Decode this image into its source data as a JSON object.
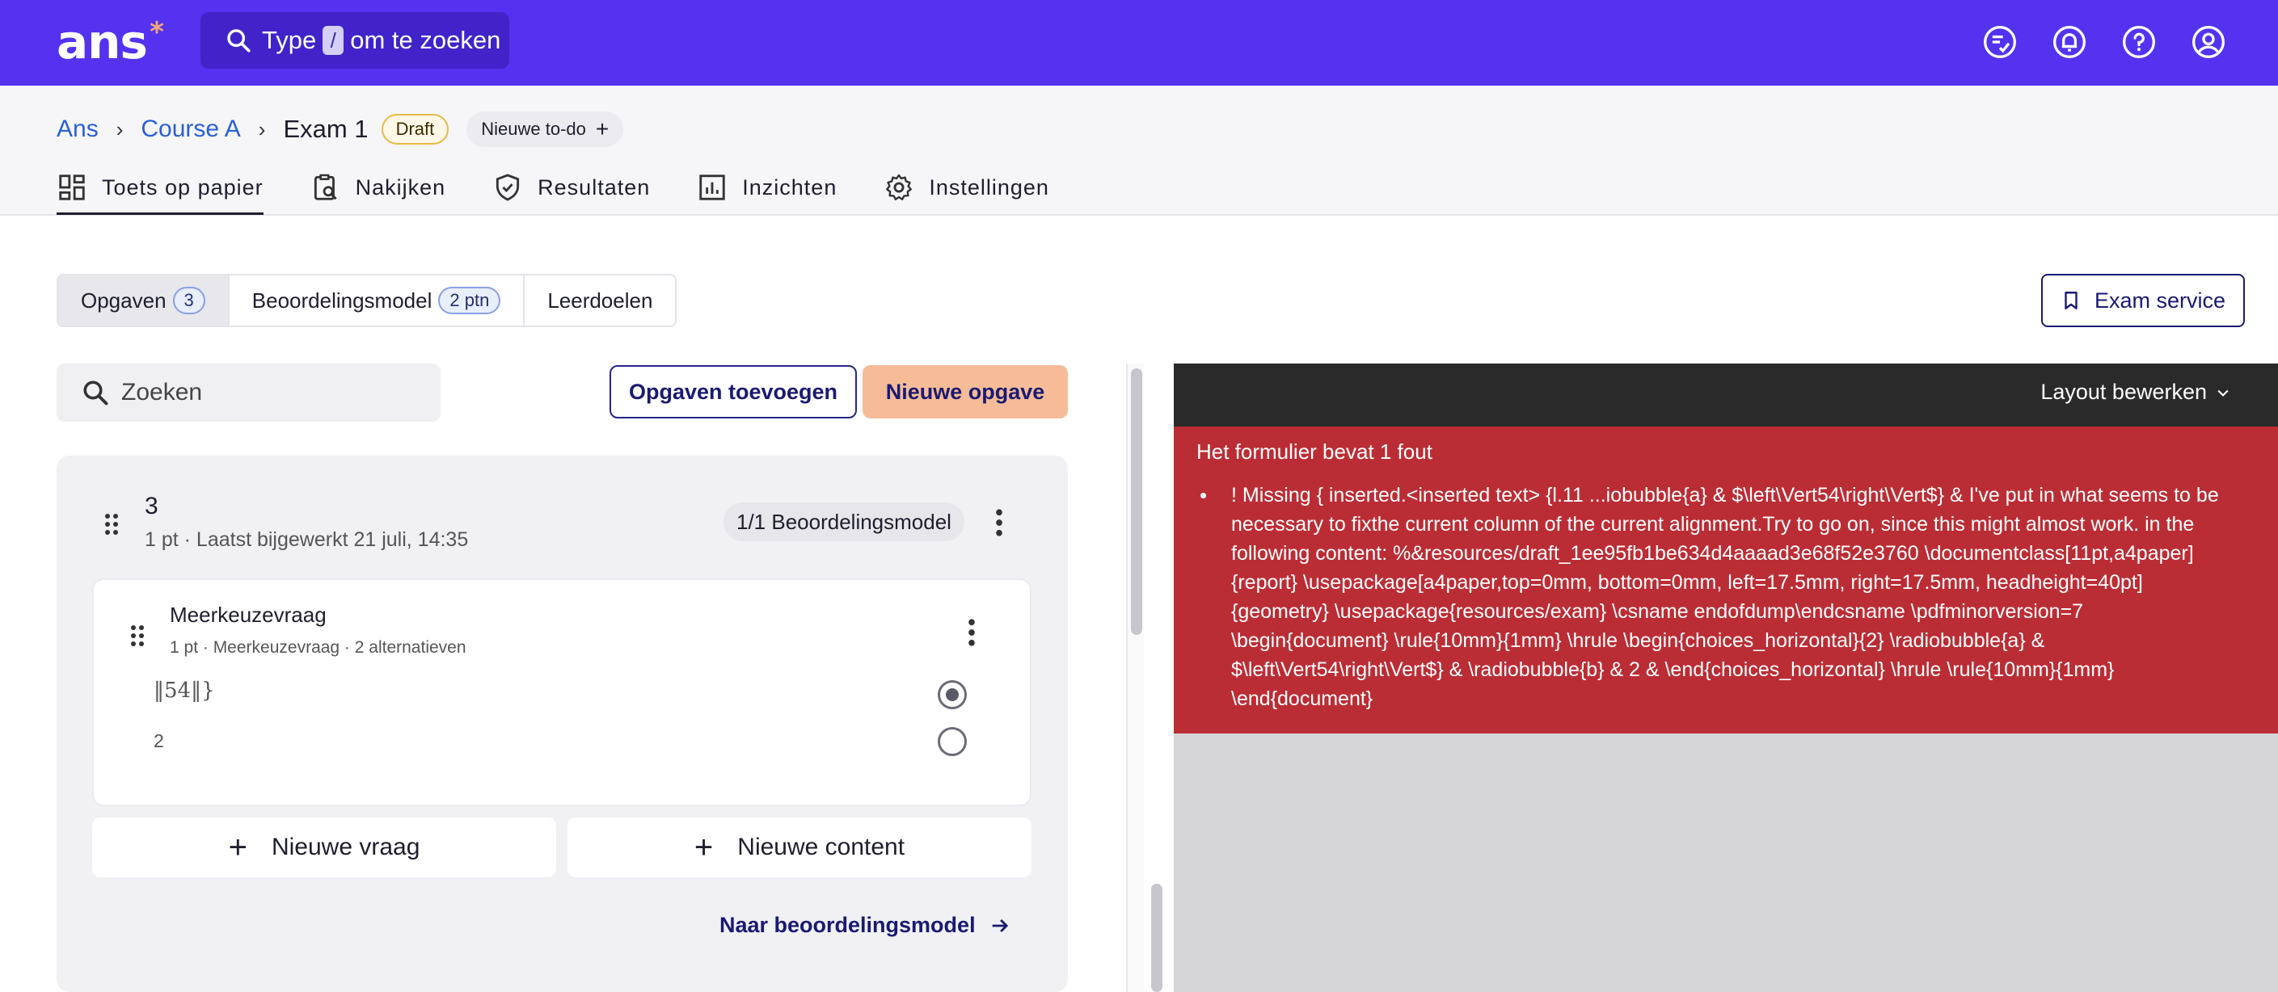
{
  "app": {
    "logo": "ans",
    "logo_star": "*",
    "search": {
      "prefix": "Type",
      "key": "/",
      "suffix": "om te zoeken"
    },
    "top_icons": [
      "todo-list-icon",
      "notification-bell-icon",
      "help-icon",
      "account-icon"
    ]
  },
  "breadcrumb": {
    "items": [
      "Ans",
      "Course A"
    ],
    "current": "Exam 1",
    "status_badge": "Draft",
    "todo_button": "Nieuwe to-do"
  },
  "tabs": [
    {
      "label": "Toets op papier",
      "icon": "dashboard-icon",
      "active": true
    },
    {
      "label": "Nakijken",
      "icon": "clipboard-search-icon",
      "active": false
    },
    {
      "label": "Resultaten",
      "icon": "shield-check-icon",
      "active": false
    },
    {
      "label": "Inzichten",
      "icon": "bar-chart-icon",
      "active": false
    },
    {
      "label": "Instellingen",
      "icon": "gear-icon",
      "active": false
    }
  ],
  "segments": {
    "opgaven": {
      "label": "Opgaven",
      "count": "3"
    },
    "beoordelingsmodel": {
      "label": "Beoordelingsmodel",
      "count": "2 ptn"
    },
    "leerdoelen": {
      "label": "Leerdoelen"
    }
  },
  "exam_service": "Exam service",
  "left": {
    "search_placeholder": "Zoeken",
    "add_existing": "Opgaven toevoegen",
    "new_exercise": "Nieuwe opgave",
    "exercise": {
      "number": "3",
      "meta": "1 pt · Laatst bijgewerkt 21 juli, 14:35",
      "model_badge": "1/1 Beoordelingsmodel",
      "question": {
        "type": "Meerkeuzevraag",
        "meta": "1 pt · Meerkeuzevraag · 2 alternatieven",
        "alternatives": [
          {
            "text": "‖54‖}",
            "selected": true
          },
          {
            "text": "2",
            "selected": false
          }
        ]
      },
      "new_question": "Nieuwe vraag",
      "new_content": "Nieuwe content",
      "to_model": "Naar beoordelingsmodel"
    }
  },
  "preview": {
    "layout_button": "Layout bewerken",
    "error_title": "Het formulier bevat 1 fout",
    "error_lines": [
      "! Missing { inserted.<inserted text> {l.11 ...iobubble{a} & $\\left\\Vert54\\right\\Vert$} & I've put in what seems to be",
      "necessary to fixthe current column of the current alignment.Try to go on, since this might almost work. in the",
      "following content: %&resources/draft_1ee95fb1be634d4aaaad3e68f52e3760 \\documentclass[11pt,a4paper]",
      "{report} \\usepackage[a4paper,top=0mm, bottom=0mm, left=17.5mm, right=17.5mm, headheight=40pt]",
      "{geometry} \\usepackage{resources/exam} \\csname endofdump\\endcsname \\pdfminorversion=7",
      "\\begin{document} \\rule{10mm}{1mm} \\hrule \\begin{choices_horizontal}{2} \\radiobubble{a} &",
      "$\\left\\Vert54\\right\\Vert$} & \\radiobubble{b} & 2 & \\end{choices_horizontal} \\hrule \\rule{10mm}{1mm}",
      "\\end{document}"
    ]
  },
  "colors": {
    "brand": "#5432f0",
    "accent_button": "#f6bc98",
    "error": "#bb2d35",
    "link": "#2b5fd6"
  }
}
